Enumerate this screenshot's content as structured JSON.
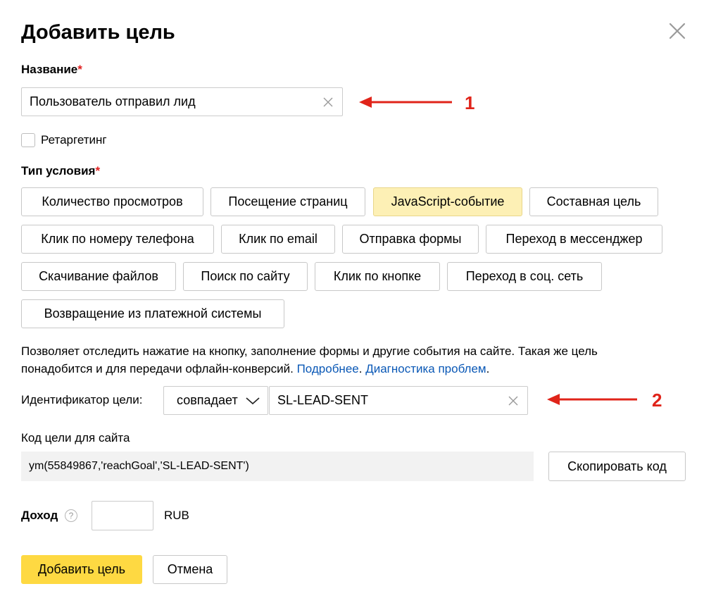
{
  "dialog": {
    "title": "Добавить цель",
    "name_label": "Название",
    "required_mark": "*",
    "name_value": "Пользователь отправил лид",
    "retargeting_label": "Ретаргетинг",
    "condition_label": "Тип условия",
    "condition_types": [
      "Количество просмотров",
      "Посещение страниц",
      "JavaScript-событие",
      "Составная цель",
      "Клик по номеру телефона",
      "Клик по email",
      "Отправка формы",
      "Переход в мессенджер",
      "Скачивание файлов",
      "Поиск по сайту",
      "Клик по кнопке",
      "Переход в соц. сеть",
      "Возвращение из платежной системы"
    ],
    "selected_condition": "JavaScript-событие",
    "description_line1": "Позволяет отследить нажатие на кнопку, заполнение формы и другие события на сайте. Такая же цель",
    "description_line2": "понадобится и для передачи офлайн-конверсий.",
    "more_link": "Подробнее",
    "diagnostics_link": "Диагностика проблем",
    "identifier_label": "Идентификатор цели:",
    "match_select": "совпадает",
    "identifier_value": "SL-LEAD-SENT",
    "code_label": "Код цели для сайта",
    "code_value": "ym(55849867,'reachGoal','SL-LEAD-SENT')",
    "copy_button": "Скопировать код",
    "income_label": "Доход",
    "income_value": "",
    "currency": "RUB",
    "add_button": "Добавить цель",
    "cancel_button": "Отмена"
  },
  "annotations": {
    "arrow1_number": "1",
    "arrow2_number": "2"
  },
  "colors": {
    "accent_yellow": "#fed942",
    "selected_bg": "#fdf0b5",
    "link": "#0a58b6",
    "annotation_red": "#e0241a"
  }
}
